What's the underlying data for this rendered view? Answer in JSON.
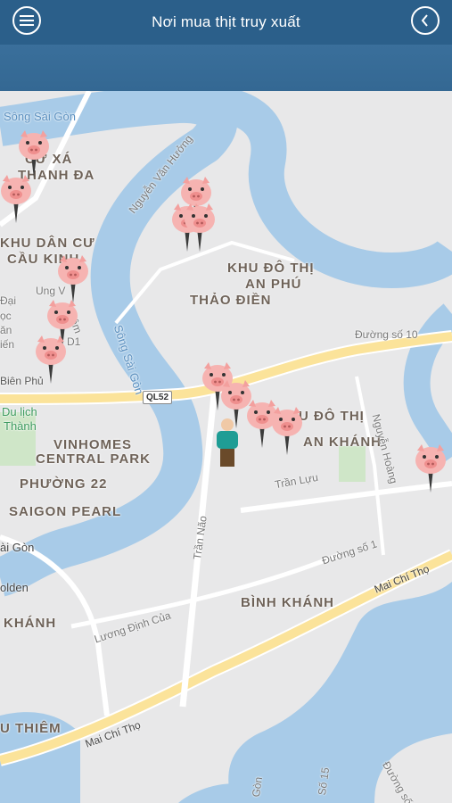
{
  "header": {
    "title": "Nơi mua thịt truy xuất"
  },
  "icons": {
    "menu": "hamburger-icon",
    "back": "chevron-left-icon",
    "pin": "pig-marker-icon",
    "user": "person-icon"
  },
  "colors": {
    "header": "#2b5f8a",
    "river": "#a8cbe8",
    "road": "#fbe39a"
  },
  "map": {
    "labels": {
      "song_sai_gon_top": "Sông Sài Gòn",
      "cu_xa": "CƯ XÁ",
      "thanh_da": "THANH ĐA",
      "khu_dan_cu": "KHU DÂN CƯ",
      "cau_kinh": "CẦU KINH",
      "nguyen_van_huong": "Nguyễn Văn Hưởng",
      "khu_do_thi": "KHU ĐÔ THỊ",
      "an_phu": "AN PHÚ",
      "thao_dien": "THẢO ĐIỀN",
      "ung_v": "Ung V",
      "khiem": "Khiêm",
      "dai": "Đại",
      "hoc": "ọc",
      "van": "ăn",
      "hien": "iến",
      "d1": "D1",
      "song_sai_gon_mid": "Sông Sài Gòn",
      "duong_so_10": "Đường số 10",
      "bien_phu": "Biên Phủ",
      "ql52": "QL52",
      "khu_do_thi_2": "U ĐÔ THỊ",
      "an_khanh": "AN KHÁNH",
      "du_lich": "Du lịch",
      "thanh": "Thành",
      "vinhomes": "VINHOMES",
      "central_park": "CENTRAL PARK",
      "nguyen_hoang": "Nguyễn Hoàng",
      "phuong_22": "PHƯỜNG 22",
      "tran_luu": "Trần Lựu",
      "saigon_pearl": "SAIGON PEARL",
      "ai_gon": "ài Gòn",
      "duong_so_1": "Đường số 1",
      "mai_chi_tho_1": "Mai Chí Thọ",
      "tran_nao": "Trần Não",
      "olden": "olden",
      "luong_dinh_cua": "Lương Định Của",
      "binh_khanh": "BÌNH KHÁNH",
      "khanh_left": "KHÁNH",
      "u_thiem": "U THIÊM",
      "mai_chi_tho_2": "Mai Chí Thọ",
      "gon": "Gòn",
      "so_15": "Số 15",
      "duong_so_2": "Đường số 2"
    }
  }
}
